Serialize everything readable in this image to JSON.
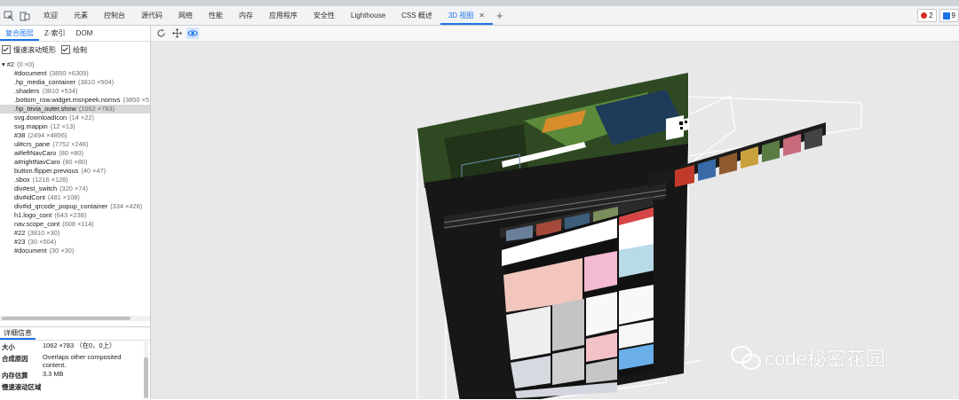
{
  "tabbar": {
    "tabs": [
      "欢迎",
      "元素",
      "控制台",
      "源代码",
      "网络",
      "性能",
      "内存",
      "应用程序",
      "安全性",
      "Lighthouse",
      "CSS 概述",
      "3D 视图"
    ],
    "active_tab": "3D 视图",
    "error_count": "2",
    "issue_count": "9"
  },
  "left": {
    "subtabs": [
      "复合图层",
      "Z-索引",
      "DOM"
    ],
    "checkbox_scroll": "慢速滚动矩形",
    "checkbox_paint": "绘制",
    "tree": [
      {
        "label": "#2",
        "dim": "(0 ×0)"
      },
      {
        "label": "#document",
        "dim": "(3850 ×6309)"
      },
      {
        "label": ".hp_media_container",
        "dim": "(3810 ×504)"
      },
      {
        "label": ".shaders",
        "dim": "(3810 ×534)"
      },
      {
        "label": ".bottom_row.widget.msnpeek.nomvs",
        "dim": "(3850 ×5"
      },
      {
        "label": ".hp_trivia_outer.show",
        "dim": "(1062 ×783)"
      },
      {
        "label": "svg.downloadIcon",
        "dim": "(14 ×22)"
      },
      {
        "label": "svg.mappin",
        "dim": "(12 ×13)"
      },
      {
        "label": "#38",
        "dim": "(2494 ×4856)"
      },
      {
        "label": "ul#crs_pane",
        "dim": "(7752 ×248)"
      },
      {
        "label": "a#leftNavCaro",
        "dim": "(80 ×80)"
      },
      {
        "label": "a#rightNavCaro",
        "dim": "(80 ×80)"
      },
      {
        "label": "button.flipper.previous",
        "dim": "(40 ×47)"
      },
      {
        "label": ".sbox",
        "dim": "(1216 ×128)"
      },
      {
        "label": "div#est_switch",
        "dim": "(320 ×74)"
      },
      {
        "label": "div#idCont",
        "dim": "(481 ×108)"
      },
      {
        "label": "div#id_qrcode_popup_container",
        "dim": "(334 ×428)"
      },
      {
        "label": "h1.logo_cont",
        "dim": "(643 ×238)"
      },
      {
        "label": "nav.scope_cont",
        "dim": "(608 ×114)"
      },
      {
        "label": "#22",
        "dim": "(3810 ×30)"
      },
      {
        "label": "#23",
        "dim": "(30 ×504)"
      },
      {
        "label": "#document",
        "dim": "(30 ×30)"
      }
    ],
    "details_tab": "详细信息",
    "details": [
      {
        "k": "大小",
        "v": "1062 ×783 （在0，0上）"
      },
      {
        "k": "合成原因",
        "v": "Overlaps other composited content."
      },
      {
        "k": "内存估算",
        "v": "3.3 MB"
      },
      {
        "k": "慢速滚动区域",
        "v": ""
      }
    ]
  },
  "watermark": "code秘密花园",
  "colors": {
    "accent": "#1a73e8",
    "canvas": "#e8e8e8",
    "error": "#d93025"
  }
}
